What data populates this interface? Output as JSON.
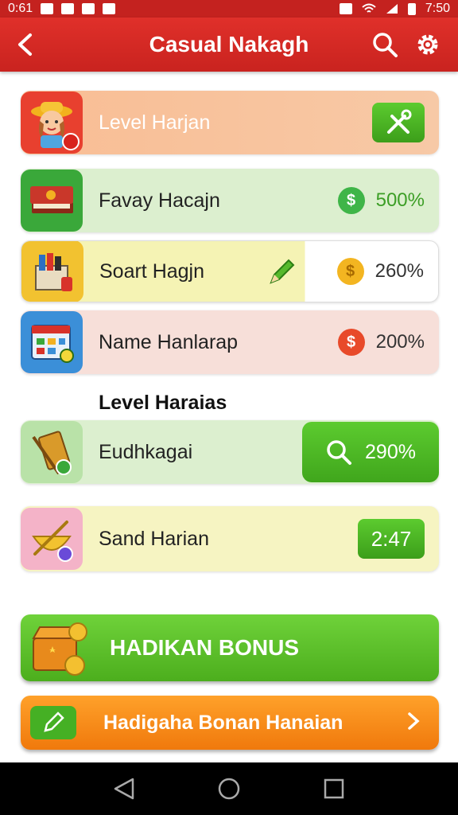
{
  "status_bar": {
    "left_text": "0:61",
    "time": "7:50"
  },
  "header": {
    "title": "Casual Nakagh"
  },
  "colors": {
    "header_red": "#d42a25",
    "accent_green": "#4cae1d",
    "accent_orange": "#f58a16"
  },
  "cards": [
    {
      "label": "Level Harjan",
      "value": "",
      "action_icon": "tools-icon"
    },
    {
      "label": "Favay Hacajn",
      "value": "500%",
      "coin_icon": "green-coin-icon"
    },
    {
      "label": "Soart Hagjn",
      "value": "260%",
      "coin_icon": "gold-coin-icon"
    },
    {
      "label": "Name Hanlarap",
      "value": "200%",
      "coin_icon": "red-coin-icon"
    }
  ],
  "section": {
    "title": "Level Haraias"
  },
  "cards2": [
    {
      "label": "Eudhkagai",
      "value": "290%",
      "value_icon": "search-icon"
    },
    {
      "label": "Sand Harian",
      "value": "2:47"
    }
  ],
  "bonus_button": {
    "label": "HADIKAN BONUS"
  },
  "secondary_button": {
    "label": "Hadigaha Bonan Hanaian"
  }
}
